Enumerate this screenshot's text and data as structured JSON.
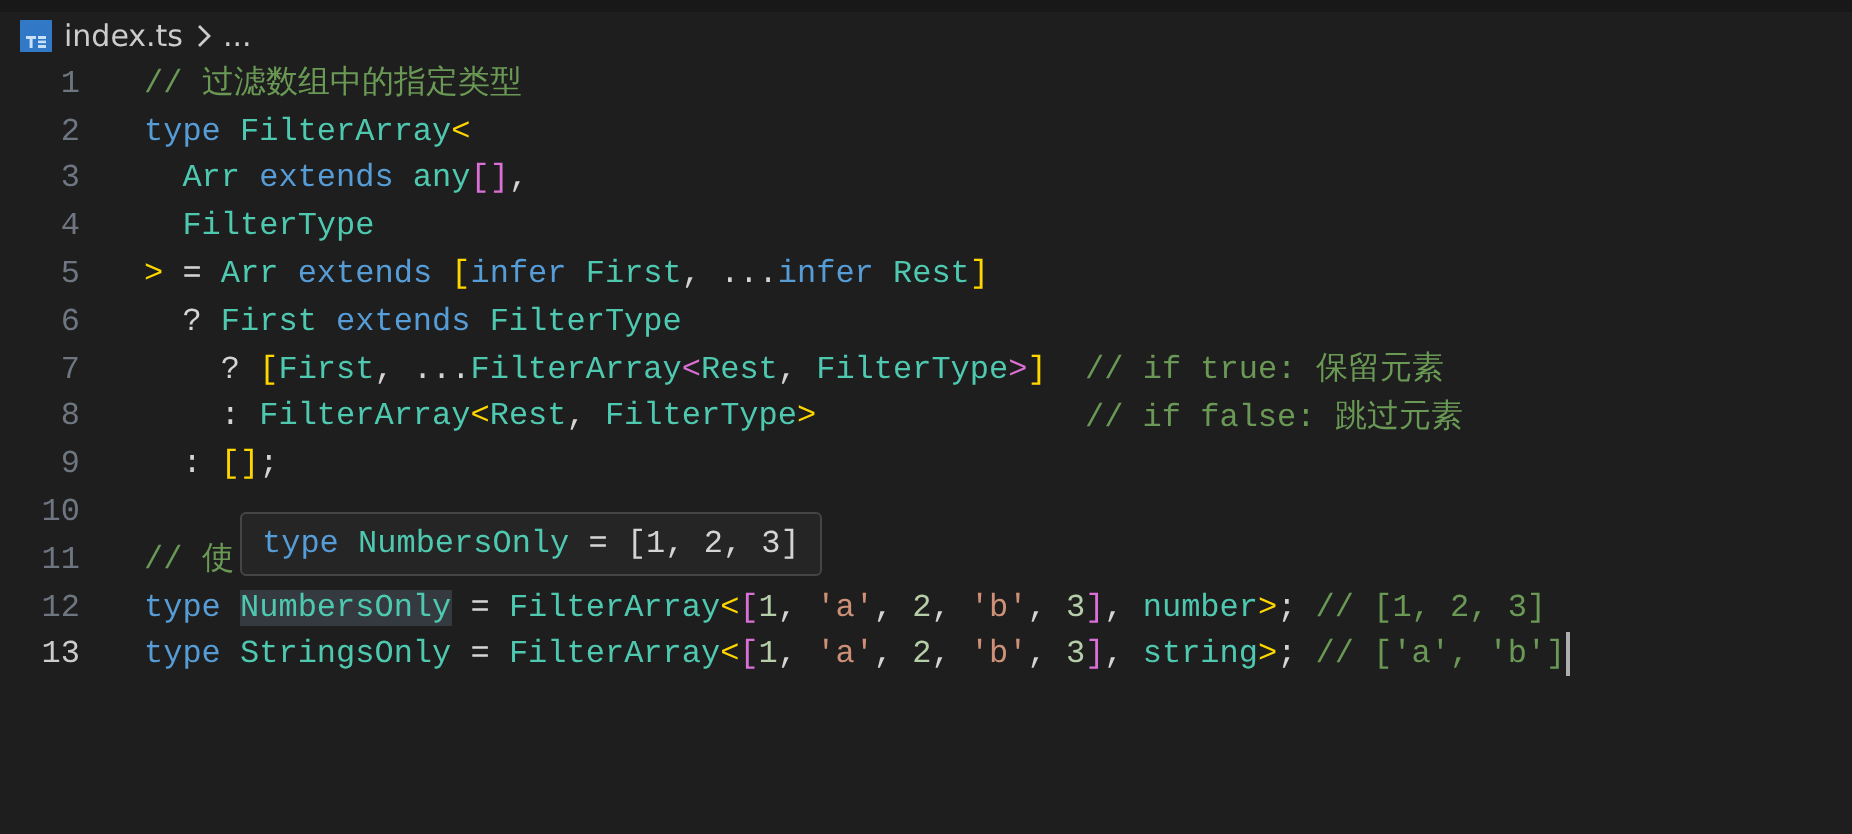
{
  "breadcrumb": {
    "file": "index.ts",
    "rest": "..."
  },
  "lines": [
    {
      "number": "1",
      "current": false,
      "tokens": [
        {
          "text": "// 过滤数组中的指定类型",
          "kind": "comment"
        }
      ]
    },
    {
      "number": "2",
      "current": false,
      "tokens": [
        {
          "text": "type ",
          "kind": "keyword"
        },
        {
          "text": "FilterArray",
          "kind": "type"
        },
        {
          "text": "<",
          "kind": "bracket"
        }
      ]
    },
    {
      "number": "3",
      "current": false,
      "tokens": [
        {
          "text": "  Arr ",
          "kind": "type"
        },
        {
          "text": "extends ",
          "kind": "keyword"
        },
        {
          "text": "any",
          "kind": "type"
        },
        {
          "text": "[]",
          "kind": "bracket2"
        },
        {
          "text": ",",
          "kind": "plain"
        }
      ]
    },
    {
      "number": "4",
      "current": false,
      "tokens": [
        {
          "text": "  FilterType",
          "kind": "type"
        }
      ]
    },
    {
      "number": "5",
      "current": false,
      "tokens": [
        {
          "text": ">",
          "kind": "bracket"
        },
        {
          "text": " = ",
          "kind": "plain"
        },
        {
          "text": "Arr ",
          "kind": "type"
        },
        {
          "text": "extends ",
          "kind": "keyword"
        },
        {
          "text": "[",
          "kind": "bracket"
        },
        {
          "text": "infer ",
          "kind": "keyword"
        },
        {
          "text": "First",
          "kind": "type"
        },
        {
          "text": ", ...",
          "kind": "plain"
        },
        {
          "text": "infer ",
          "kind": "keyword"
        },
        {
          "text": "Rest",
          "kind": "type"
        },
        {
          "text": "]",
          "kind": "bracket"
        }
      ]
    },
    {
      "number": "6",
      "current": false,
      "tokens": [
        {
          "text": "  ? ",
          "kind": "plain"
        },
        {
          "text": "First ",
          "kind": "type"
        },
        {
          "text": "extends ",
          "kind": "keyword"
        },
        {
          "text": "FilterType",
          "kind": "type"
        }
      ]
    },
    {
      "number": "7",
      "current": false,
      "tokens": [
        {
          "text": "    ? ",
          "kind": "plain"
        },
        {
          "text": "[",
          "kind": "bracket"
        },
        {
          "text": "First",
          "kind": "type"
        },
        {
          "text": ", ...",
          "kind": "plain"
        },
        {
          "text": "FilterArray",
          "kind": "type"
        },
        {
          "text": "<",
          "kind": "bracket2"
        },
        {
          "text": "Rest",
          "kind": "type"
        },
        {
          "text": ", ",
          "kind": "plain"
        },
        {
          "text": "FilterType",
          "kind": "type"
        },
        {
          "text": ">",
          "kind": "bracket2"
        },
        {
          "text": "]",
          "kind": "bracket"
        },
        {
          "text": "  // if true: 保留元素",
          "kind": "comment"
        }
      ]
    },
    {
      "number": "8",
      "current": false,
      "tokens": [
        {
          "text": "    : ",
          "kind": "plain"
        },
        {
          "text": "FilterArray",
          "kind": "type"
        },
        {
          "text": "<",
          "kind": "bracket"
        },
        {
          "text": "Rest",
          "kind": "type"
        },
        {
          "text": ", ",
          "kind": "plain"
        },
        {
          "text": "FilterType",
          "kind": "type"
        },
        {
          "text": ">",
          "kind": "bracket"
        },
        {
          "text": "              // if false: 跳过元素",
          "kind": "comment"
        }
      ]
    },
    {
      "number": "9",
      "current": false,
      "tokens": [
        {
          "text": "  : ",
          "kind": "plain"
        },
        {
          "text": "[]",
          "kind": "bracket"
        },
        {
          "text": ";",
          "kind": "plain"
        }
      ]
    },
    {
      "number": "10",
      "current": false
    },
    {
      "number": "11",
      "current": false,
      "tokens": [
        {
          "text": "// 使",
          "kind": "comment"
        }
      ]
    },
    {
      "number": "12",
      "current": false,
      "tokens": [
        {
          "text": "type ",
          "kind": "keyword"
        },
        {
          "text": "NumbersOnly",
          "kind": "type",
          "highlighted": true
        },
        {
          "text": " = ",
          "kind": "plain"
        },
        {
          "text": "FilterArray",
          "kind": "type"
        },
        {
          "text": "<",
          "kind": "bracket"
        },
        {
          "text": "[",
          "kind": "bracket2"
        },
        {
          "text": "1",
          "kind": "number"
        },
        {
          "text": ", ",
          "kind": "plain"
        },
        {
          "text": "'a'",
          "kind": "string"
        },
        {
          "text": ", ",
          "kind": "plain"
        },
        {
          "text": "2",
          "kind": "number"
        },
        {
          "text": ", ",
          "kind": "plain"
        },
        {
          "text": "'b'",
          "kind": "string"
        },
        {
          "text": ", ",
          "kind": "plain"
        },
        {
          "text": "3",
          "kind": "number"
        },
        {
          "text": "]",
          "kind": "bracket2"
        },
        {
          "text": ", ",
          "kind": "plain"
        },
        {
          "text": "number",
          "kind": "type"
        },
        {
          "text": ">",
          "kind": "bracket"
        },
        {
          "text": "; ",
          "kind": "plain"
        },
        {
          "text": "// [1, 2, 3]",
          "kind": "comment"
        }
      ]
    },
    {
      "number": "13",
      "current": true,
      "tokens": [
        {
          "text": "type ",
          "kind": "keyword"
        },
        {
          "text": "StringsOnly",
          "kind": "type"
        },
        {
          "text": " = ",
          "kind": "plain"
        },
        {
          "text": "FilterArray",
          "kind": "type"
        },
        {
          "text": "<",
          "kind": "bracket"
        },
        {
          "text": "[",
          "kind": "bracket2"
        },
        {
          "text": "1",
          "kind": "number"
        },
        {
          "text": ", ",
          "kind": "plain"
        },
        {
          "text": "'a'",
          "kind": "string"
        },
        {
          "text": ", ",
          "kind": "plain"
        },
        {
          "text": "2",
          "kind": "number"
        },
        {
          "text": ", ",
          "kind": "plain"
        },
        {
          "text": "'b'",
          "kind": "string"
        },
        {
          "text": ", ",
          "kind": "plain"
        },
        {
          "text": "3",
          "kind": "number"
        },
        {
          "text": "]",
          "kind": "bracket2"
        },
        {
          "text": ", ",
          "kind": "plain"
        },
        {
          "text": "string",
          "kind": "type"
        },
        {
          "text": ">",
          "kind": "bracket"
        },
        {
          "text": "; ",
          "kind": "plain"
        },
        {
          "text": "// ['a', 'b']",
          "kind": "comment"
        }
      ]
    }
  ],
  "hover": {
    "tokens": [
      {
        "text": "type ",
        "kind": "keyword"
      },
      {
        "text": "NumbersOnly",
        "kind": "type"
      },
      {
        "text": " = [1, 2, 3]",
        "kind": "plain"
      }
    ]
  }
}
